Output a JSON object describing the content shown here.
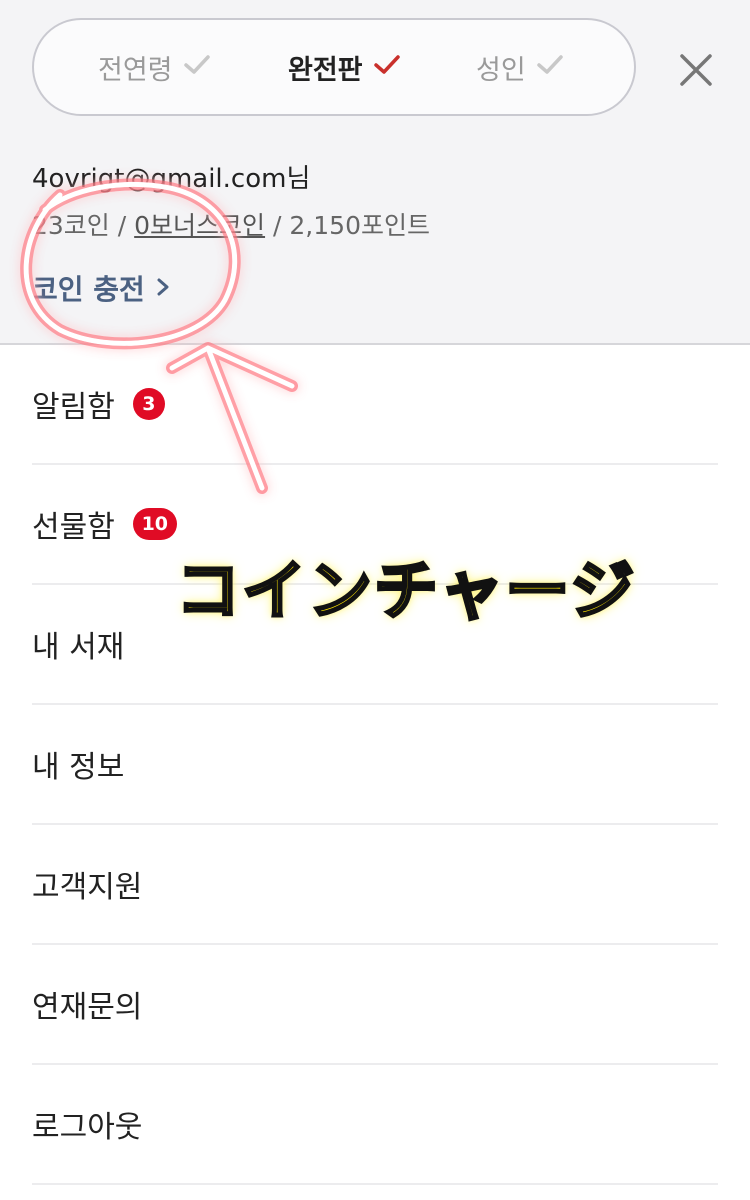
{
  "filters": [
    {
      "label": "전연령",
      "active": false
    },
    {
      "label": "완전판",
      "active": true
    },
    {
      "label": "성인",
      "active": false
    }
  ],
  "account": {
    "email": "4ovrigt@gmail.com님",
    "coins": "23코인",
    "sep1": "/",
    "bonus_coins": "0보너스코인",
    "sep2": "/",
    "points": "2,150포인트",
    "charge_label": "코인 충전"
  },
  "menu": [
    {
      "label": "알림함",
      "badge": "3"
    },
    {
      "label": "선물함",
      "badge": "10"
    },
    {
      "label": "내 서재"
    },
    {
      "label": "내 정보"
    },
    {
      "label": "고객지원"
    },
    {
      "label": "연재문의"
    },
    {
      "label": "로그아웃"
    }
  ],
  "annotation": {
    "text": "コインチャージ"
  },
  "colors": {
    "active_check": "#c9302c",
    "inactive_check": "#c8c8c8",
    "badge": "#e00b25",
    "charge_link": "#4b6182",
    "annotation_stroke": "#ff3b4e",
    "annotation_text": "#ffe600"
  },
  "icons": {
    "check": "check-icon",
    "close": "close-icon",
    "chevron": "chevron-right-icon"
  }
}
